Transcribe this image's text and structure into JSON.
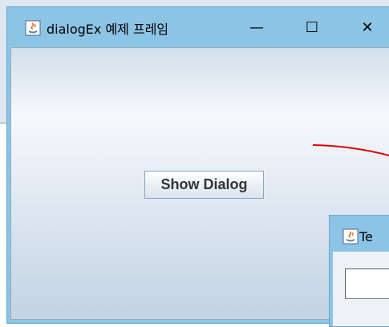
{
  "window": {
    "title": "dialogEx 예제 프레임",
    "minimize_glyph": "—",
    "maximize_glyph": "☐",
    "close_glyph": "✕",
    "icon": "java-icon"
  },
  "main": {
    "show_dialog_label": "Show Dialog"
  },
  "dialog": {
    "title": "Te",
    "icon": "java-icon",
    "input_value": ""
  },
  "colors": {
    "titlebar": "#8cc4e6",
    "annotation_line": "#e00000"
  }
}
